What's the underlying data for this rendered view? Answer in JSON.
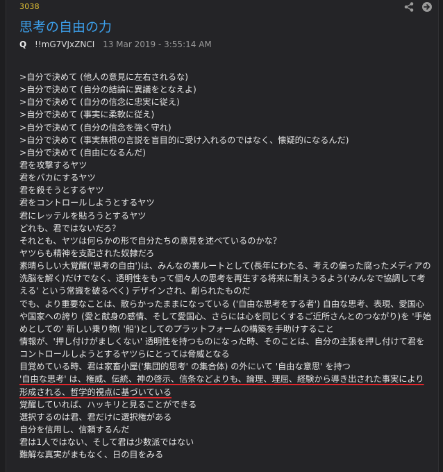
{
  "post": {
    "number": "3038",
    "title": "思考の自由の力",
    "author": "Q",
    "tripcode": "!!mG7VJxZNCI",
    "timestamp": "13 Mar 2019 - 3:55:14 AM"
  },
  "icons": {
    "share": "share-icon",
    "next": "arrow-right-circle-icon"
  },
  "colors": {
    "accent_yellow": "#e3c235",
    "title_blue": "#3ca0ec",
    "underline_red": "#e0262b"
  },
  "lines": [
    ">自分で決めて (他人の意見に左右されるな)",
    ">自分で決めて (自分の結論に異議をとなえよ)",
    ">自分で決めて (自分の信念に忠実に従え)",
    ">自分で決めて (事実に柔軟に従え)",
    ">自分で決めて (自分の信念を強く守れ)",
    ">自分で決めて (事実無根の言説を盲目的に受け入れるのではなく、懐疑的になるんだ)",
    ">自分で決めて (自由になるんだ)",
    "君を攻撃するヤツ",
    "君をバカにするヤツ",
    "君を殺そうとするヤツ",
    "君をコントロールしようとするヤツ",
    "君にレッテルを貼ろうとするヤツ",
    "どれも、君ではないだろ？",
    "それとも、ヤツは何らかの形で自分たちの意見を述べているのかな？",
    "ヤツらも精神を支配された奴隷だろ",
    "素晴らしい大覚醒('思考の自由')は、みんなの裏ルートとして(長年にわたる、考えの偏った腐ったメディアの",
    "洗脳を解く)だけでなく、透明性をもって個々人の思考を再生する将来に耐えうるよう('みんなで協調して考",
    "える' という常識を破るべく) デザインされ、創られたものだ",
    "でも、より重要なことは、散らかったままになっている ('自由な思考をする者') 自由な思考、表現、愛国心",
    "や国家への誇り (愛と献身の感情、そして愛国心、さらには心を同じくするご近所さんとのつながり)を '手始",
    "めとしての' 新しい乗り物( '船')としてのプラットフォームの構築を手助けすること",
    "情報が、'押し付けがましくない' 透明性を持つものになった時、そのことは、自分の主張を押し付けて君を",
    "コントロールしようとするヤツらにとっては脅威となる",
    "目覚めている時、君は家畜小屋('集団的思考' の集合体) の外にいて '自由な意思' を持つ",
    "'自由な思考' は、権威、伝統、神の啓示、信条などよりも、論理、理屈、経験から導き出された事実により",
    "形成される、哲学的視点に基づいている",
    "覚醒していれば、ハッキリと見ることができる",
    "選択するのは君、君だけに選択権がある",
    "自分を信用し、信頼するんだ",
    "君は1人ではない、そして君は少数派ではない",
    "難解な真実がまもなく、日の目をみる"
  ]
}
